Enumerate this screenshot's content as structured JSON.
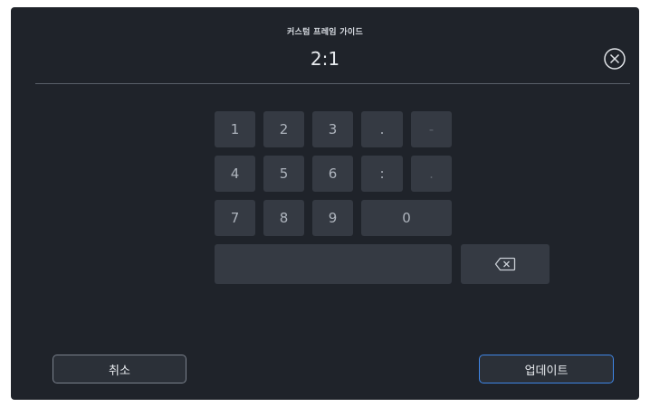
{
  "header": {
    "subtitle": "커스텀 프레임 가이드",
    "value": "2:1"
  },
  "close_icon": "close-circle-icon",
  "keypad": {
    "keys": [
      "1",
      "2",
      "3",
      ".",
      "-",
      "4",
      "5",
      "6",
      ":",
      ".",
      "7",
      "8",
      "9",
      "0"
    ],
    "backspace_icon": "backspace-icon"
  },
  "footer": {
    "cancel_label": "취소",
    "update_label": "업데이트"
  },
  "colors": {
    "background": "#1f232a",
    "key": "#353a43",
    "accent": "#3f86e6"
  }
}
